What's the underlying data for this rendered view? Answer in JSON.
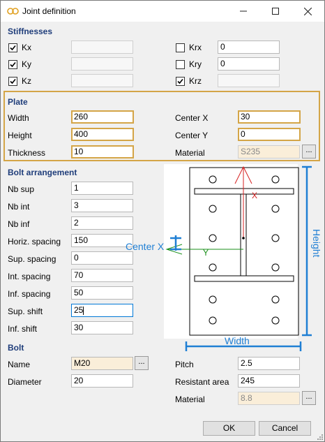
{
  "window": {
    "title": "Joint definition",
    "icon": "joint-icon"
  },
  "stiffnesses": {
    "title": "Stiffnesses",
    "rows": [
      {
        "label": "Kx",
        "checked": true,
        "value": ""
      },
      {
        "label": "Ky",
        "checked": true,
        "value": ""
      },
      {
        "label": "Kz",
        "checked": true,
        "value": ""
      }
    ],
    "rot_rows": [
      {
        "label": "Krx",
        "checked": false,
        "value": "0"
      },
      {
        "label": "Kry",
        "checked": false,
        "value": "0"
      },
      {
        "label": "Krz",
        "checked": true,
        "value": ""
      }
    ]
  },
  "plate": {
    "title": "Plate",
    "width_label": "Width",
    "width": "260",
    "height_label": "Height",
    "height": "400",
    "thickness_label": "Thickness",
    "thickness": "10",
    "centerx_label": "Center X",
    "centerx": "30",
    "centery_label": "Center Y",
    "centery": "0",
    "material_label": "Material",
    "material": "S235",
    "browse": "..."
  },
  "bolt_arrangement": {
    "title": "Bolt arrangement",
    "fields": [
      {
        "label": "Nb sup",
        "value": "1"
      },
      {
        "label": "Nb int",
        "value": "3"
      },
      {
        "label": "Nb inf",
        "value": "2"
      },
      {
        "label": "Horiz. spacing",
        "value": "150"
      },
      {
        "label": "Sup. spacing",
        "value": "0"
      },
      {
        "label": "Int. spacing",
        "value": "70"
      },
      {
        "label": "Inf. spacing",
        "value": "50"
      },
      {
        "label": "Sup. shift",
        "value": "25"
      },
      {
        "label": "Inf. shift",
        "value": "30"
      }
    ]
  },
  "diagram": {
    "x_axis": "X",
    "y_axis": "Y",
    "center_x": "Center X",
    "height": "Height",
    "width": "Width",
    "colors": {
      "accent": "#1f7fd4",
      "x_axis": "#d62020",
      "y_axis": "#1a8f1a"
    }
  },
  "bolt": {
    "title": "Bolt",
    "name_label": "Name",
    "name": "M20",
    "diameter_label": "Diameter",
    "diameter": "20",
    "pitch_label": "Pitch",
    "pitch": "2.5",
    "area_label": "Resistant area",
    "area": "245",
    "material_label": "Material",
    "material": "8.8",
    "browse": "..."
  },
  "footer": {
    "ok": "OK",
    "cancel": "Cancel"
  },
  "colors": {
    "section_title": "#1f3d7a",
    "highlight": "#d4a547"
  }
}
